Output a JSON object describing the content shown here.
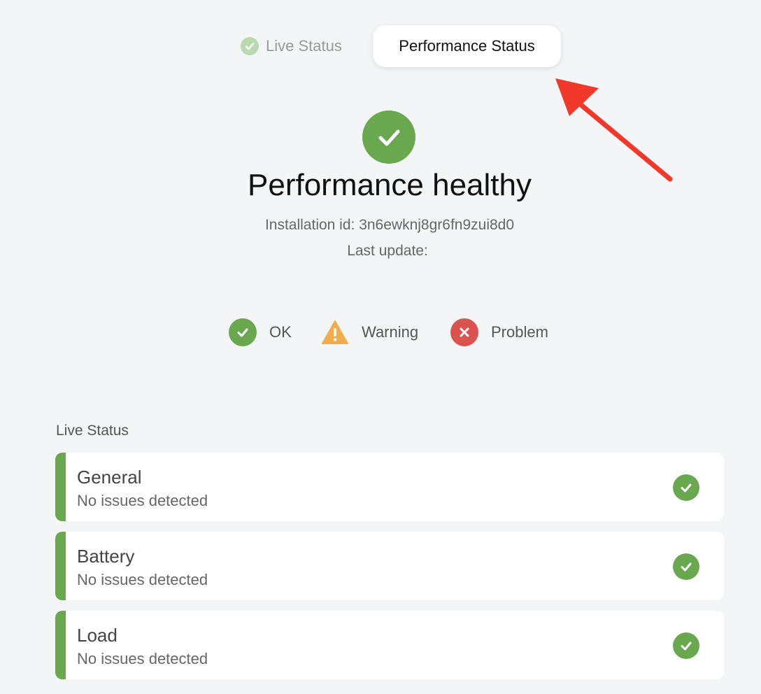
{
  "tabs": {
    "live_label": "Live Status",
    "performance_label": "Performance Status"
  },
  "header": {
    "title": "Performance healthy",
    "installation_id": "Installation id: 3n6ewknj8gr6fn9zui8d0",
    "last_update": "Last update:"
  },
  "legend": {
    "ok": "OK",
    "warning": "Warning",
    "problem": "Problem"
  },
  "section": {
    "label": "Live Status"
  },
  "items": [
    {
      "title": "General",
      "subtitle": "No issues detected",
      "status": "ok"
    },
    {
      "title": "Battery",
      "subtitle": "No issues detected",
      "status": "ok"
    },
    {
      "title": "Load",
      "subtitle": "No issues detected",
      "status": "ok"
    }
  ],
  "colors": {
    "ok": "#6aa84f",
    "warning": "#f0ad4e",
    "problem": "#d9534f",
    "annotation": "#f0392b"
  },
  "icons": {
    "ok": "check-circle-icon",
    "warning": "warning-triangle-icon",
    "problem": "x-circle-icon"
  }
}
